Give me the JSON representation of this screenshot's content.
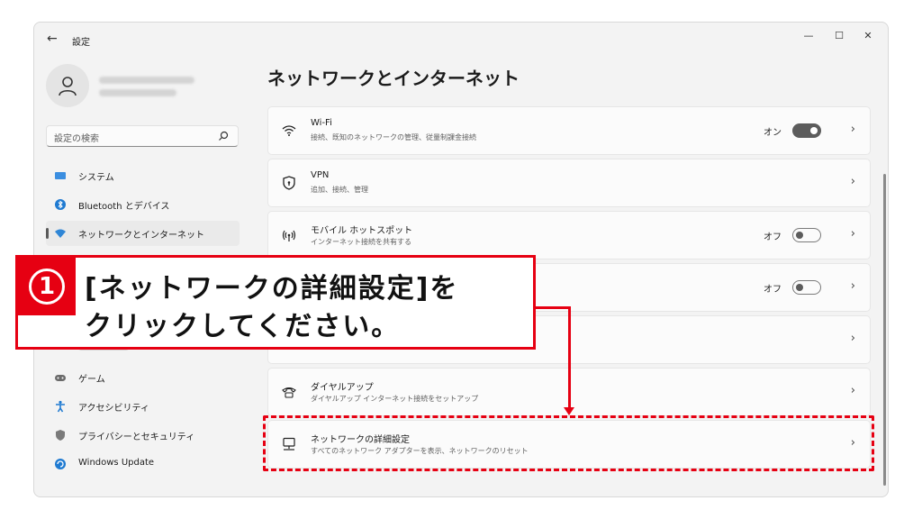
{
  "window": {
    "app_title": "設定",
    "back_icon": "back-arrow-icon",
    "controls": {
      "minimize": "—",
      "maximize": "☐",
      "close": "✕"
    }
  },
  "sidebar": {
    "search_placeholder": "設定の検索",
    "items": [
      {
        "label": "システム",
        "icon": "system-icon"
      },
      {
        "label": "Bluetooth とデバイス",
        "icon": "bluetooth-icon"
      },
      {
        "label": "ネットワークとインターネット",
        "icon": "network-icon",
        "active": true
      },
      {
        "label": "ゲーム",
        "icon": "game-icon"
      },
      {
        "label": "アクセシビリティ",
        "icon": "accessibility-icon"
      },
      {
        "label": "プライバシーとセキュリティ",
        "icon": "shield-icon"
      },
      {
        "label": "Windows Update",
        "icon": "update-icon"
      }
    ]
  },
  "main": {
    "title": "ネットワークとインターネット",
    "cards": [
      {
        "title": "Wi-Fi",
        "subtitle": "接続、既知のネットワークの管理、従量制課金接続",
        "toggle_label": "オン",
        "toggle_on": true
      },
      {
        "title": "VPN",
        "subtitle": "追加、接続、管理"
      },
      {
        "title": "モバイル ホットスポット",
        "subtitle": "インターネット接続を共有する",
        "toggle_label": "オフ",
        "toggle_on": false
      },
      {
        "toggle_label": "オフ",
        "toggle_on": false
      },
      {},
      {
        "title": "ダイヤルアップ",
        "subtitle": "ダイヤルアップ インターネット接続をセットアップ"
      },
      {
        "title": "ネットワークの詳細設定",
        "subtitle": "すべてのネットワーク アダプターを表示、ネットワークのリセット"
      }
    ]
  },
  "annotation": {
    "step_number": "1",
    "line1": "[ネットワークの詳細設定]を",
    "line2": "クリックしてください。",
    "color": "#e60012"
  }
}
